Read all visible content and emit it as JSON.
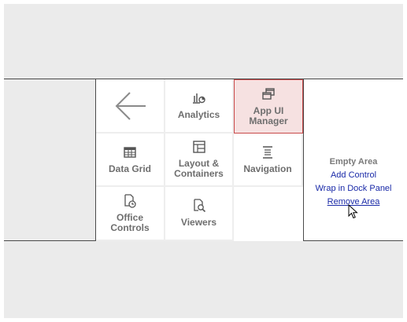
{
  "tiles": {
    "analytics": "Analytics",
    "app_ui_manager": "App UI\nManager",
    "data_grid": "Data Grid",
    "layout_containers": "Layout &\nContainers",
    "navigation": "Navigation",
    "office_controls": "Office Controls",
    "viewers": "Viewers"
  },
  "empty_area": {
    "title": "Empty Area",
    "add_control": "Add Control",
    "wrap_dock_panel": "Wrap in Dock Panel",
    "remove_area": "Remove Area"
  },
  "colors": {
    "selected_border": "#c94a4a",
    "selected_fill": "#f6e1e1",
    "link": "#1a2aa8"
  }
}
